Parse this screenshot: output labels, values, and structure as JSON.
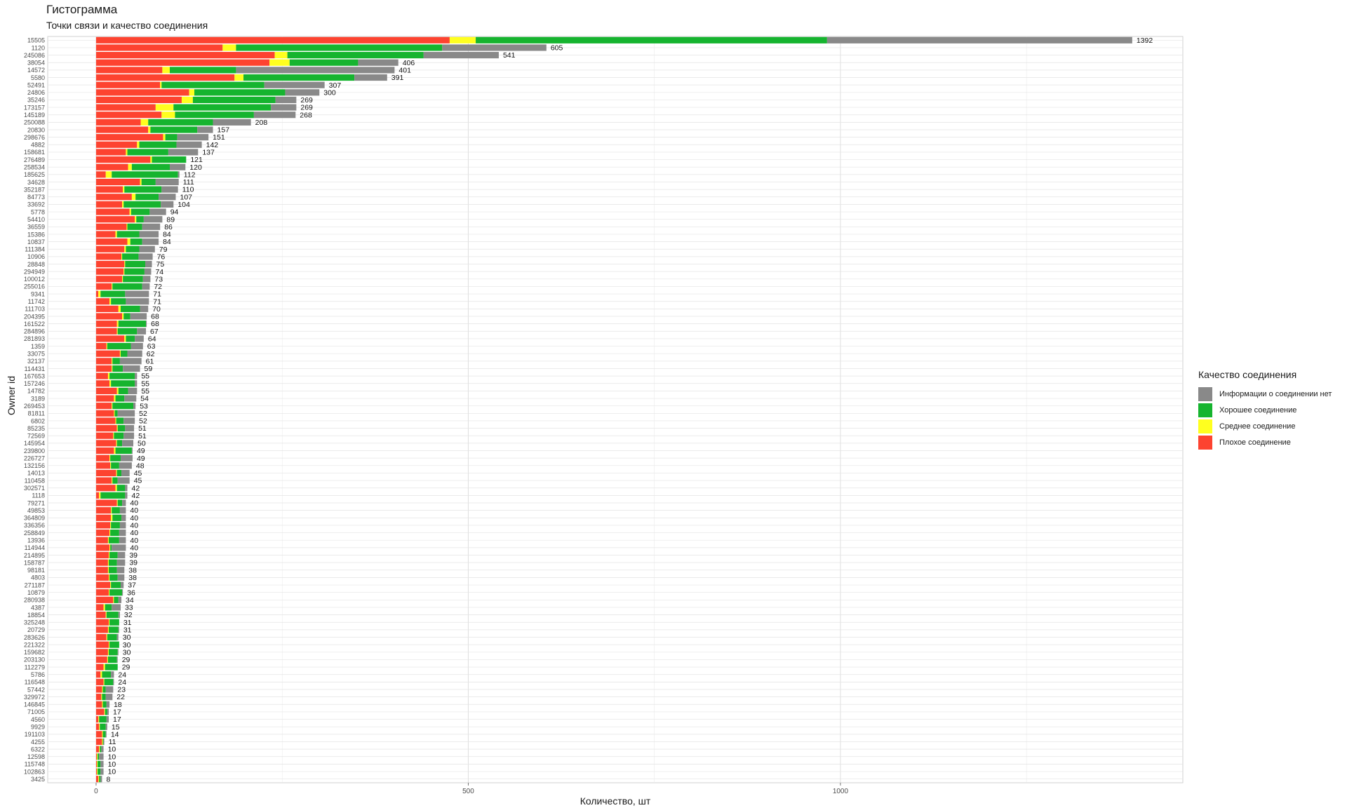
{
  "chart_data": {
    "type": "bar",
    "orientation": "horizontal",
    "stacked": true,
    "title": "Гистограмма",
    "subtitle": "Точки связи и качество соединения",
    "xlabel": "Количество, шт",
    "ylabel": "Owner id",
    "xlim": [
      -65,
      1460
    ],
    "x_ticks": [
      0,
      500,
      1000
    ],
    "grid": true,
    "legend_title": "Качество соединения",
    "legend_position": "right",
    "legend": [
      {
        "key": "none",
        "label": "Информации о соединении нет",
        "color": "#898989"
      },
      {
        "key": "good",
        "label": "Хорошее соединение",
        "color": "#16b42f"
      },
      {
        "key": "medium",
        "label": "Среднее соединение",
        "color": "#ffff1f"
      },
      {
        "key": "bad",
        "label": "Плохое соединение",
        "color": "#fd4330"
      }
    ],
    "stack_order": [
      "bad",
      "medium",
      "good",
      "none"
    ],
    "categories": [
      "15505",
      "1120",
      "245086",
      "38054",
      "14572",
      "5580",
      "52491",
      "24806",
      "35246",
      "173157",
      "145189",
      "250088",
      "20830",
      "298676",
      "4882",
      "158681",
      "276489",
      "258534",
      "185625",
      "34628",
      "352187",
      "84773",
      "33692",
      "5778",
      "54410",
      "36559",
      "15386",
      "10837",
      "111384",
      "10906",
      "28848",
      "294949",
      "100012",
      "255016",
      "9341",
      "11742",
      "111703",
      "204395",
      "161522",
      "284896",
      "281893",
      "1359",
      "33075",
      "32137",
      "114431",
      "167653",
      "157246",
      "14782",
      "3189",
      "269453",
      "81811",
      "6802",
      "85235",
      "72569",
      "145954",
      "239800",
      "226727",
      "132156",
      "14013",
      "110458",
      "302571",
      "1118",
      "79271",
      "49853",
      "364809",
      "336356",
      "258849",
      "13936",
      "114944",
      "214895",
      "158787",
      "98181",
      "4803",
      "271187",
      "10879",
      "280938",
      "4387",
      "18854",
      "325248",
      "20729",
      "283626",
      "221322",
      "159682",
      "203130",
      "112279",
      "5786",
      "116548",
      "57442",
      "329972",
      "146845",
      "71005",
      "4560",
      "9929",
      "191103",
      "4255",
      "6322",
      "12598",
      "115748",
      "102863",
      "3425"
    ],
    "totals": [
      1392,
      605,
      541,
      406,
      401,
      391,
      307,
      300,
      269,
      269,
      268,
      208,
      157,
      151,
      142,
      137,
      121,
      120,
      112,
      111,
      110,
      107,
      104,
      94,
      89,
      86,
      84,
      84,
      79,
      76,
      75,
      74,
      73,
      72,
      71,
      71,
      70,
      68,
      68,
      67,
      64,
      63,
      62,
      61,
      59,
      55,
      55,
      55,
      54,
      53,
      52,
      52,
      51,
      51,
      50,
      49,
      49,
      48,
      45,
      45,
      42,
      42,
      40,
      40,
      40,
      40,
      40,
      40,
      40,
      39,
      39,
      38,
      38,
      37,
      36,
      34,
      33,
      32,
      31,
      31,
      30,
      30,
      30,
      29,
      29,
      24,
      24,
      23,
      22,
      18,
      17,
      17,
      15,
      14,
      11,
      10,
      10,
      10,
      10,
      8
    ],
    "series": [
      {
        "key": "bad",
        "name": "Плохое соединение",
        "values": [
          475,
          170,
          240,
          233,
          89,
          186,
          86,
          125,
          115,
          80,
          88,
          60,
          70,
          90,
          55,
          40,
          73,
          43,
          13,
          59,
          36,
          48,
          35,
          45,
          52,
          41,
          26,
          42,
          38,
          34,
          38,
          37,
          35,
          21,
          3,
          18,
          30,
          35,
          28,
          28,
          38,
          14,
          32,
          21,
          21,
          16,
          18,
          28,
          24,
          21,
          24,
          26,
          28,
          23,
          27,
          24,
          18,
          19,
          27,
          21,
          26,
          4,
          28,
          20,
          20,
          19,
          18,
          16,
          18,
          17,
          16,
          16,
          17,
          19,
          17,
          23,
          10,
          13,
          17,
          16,
          14,
          17,
          16,
          15,
          10,
          6,
          10,
          8,
          7,
          8,
          11,
          3,
          4,
          8,
          8,
          4,
          1,
          1,
          1,
          3
        ]
      },
      {
        "key": "medium",
        "name": "Среднее соединение",
        "values": [
          35,
          18,
          17,
          27,
          10,
          12,
          2,
          7,
          15,
          24,
          18,
          10,
          3,
          3,
          3,
          2,
          2,
          5,
          8,
          2,
          2,
          5,
          2,
          2,
          2,
          1,
          2,
          4,
          2,
          1,
          1,
          1,
          1,
          1,
          3,
          2,
          3,
          2,
          2,
          1,
          2,
          1,
          1,
          1,
          1,
          2,
          2,
          2,
          2,
          1,
          1,
          1,
          1,
          1,
          1,
          2,
          1,
          1,
          1,
          1,
          2,
          2,
          1,
          1,
          2,
          1,
          1,
          1,
          1,
          1,
          1,
          1,
          1,
          1,
          1,
          1,
          2,
          1,
          1,
          1,
          1,
          1,
          1,
          1,
          2,
          2,
          1,
          1,
          1,
          1,
          1,
          1,
          1,
          1,
          1,
          1,
          1,
          1,
          1,
          1
        ]
      },
      {
        "key": "good",
        "name": "Хорошее соединение",
        "values": [
          472,
          277,
          183,
          92,
          89,
          149,
          138,
          122,
          111,
          131,
          106,
          87,
          63,
          16,
          50,
          55,
          46,
          51,
          89,
          19,
          50,
          31,
          50,
          25,
          10,
          20,
          30,
          16,
          18,
          22,
          27,
          27,
          27,
          40,
          33,
          20,
          26,
          9,
          37,
          26,
          12,
          32,
          9,
          10,
          14,
          34,
          32,
          13,
          12,
          28,
          4,
          10,
          10,
          13,
          7,
          22,
          14,
          11,
          6,
          7,
          11,
          33,
          6,
          11,
          12,
          12,
          12,
          14,
          2,
          11,
          11,
          11,
          11,
          13,
          17,
          6,
          9,
          16,
          13,
          13,
          13,
          13,
          12,
          12,
          17,
          12,
          12,
          4,
          5,
          5,
          3,
          10,
          8,
          4,
          1,
          2,
          2,
          4,
          4,
          2
        ]
      },
      {
        "key": "none",
        "name": "Информации о соединении нет",
        "values": [
          410,
          140,
          101,
          54,
          213,
          44,
          81,
          46,
          28,
          34,
          56,
          51,
          21,
          42,
          34,
          40,
          0,
          21,
          2,
          31,
          22,
          23,
          17,
          22,
          25,
          24,
          26,
          22,
          21,
          19,
          9,
          9,
          10,
          10,
          32,
          31,
          11,
          22,
          1,
          12,
          12,
          16,
          20,
          29,
          23,
          3,
          3,
          12,
          16,
          3,
          23,
          15,
          12,
          14,
          15,
          1,
          16,
          17,
          11,
          16,
          3,
          3,
          5,
          8,
          6,
          8,
          9,
          9,
          19,
          10,
          11,
          10,
          9,
          4,
          1,
          4,
          12,
          2,
          0,
          1,
          2,
          0,
          1,
          1,
          0,
          4,
          1,
          10,
          9,
          4,
          2,
          3,
          2,
          1,
          1,
          3,
          6,
          4,
          4,
          2
        ]
      }
    ]
  }
}
